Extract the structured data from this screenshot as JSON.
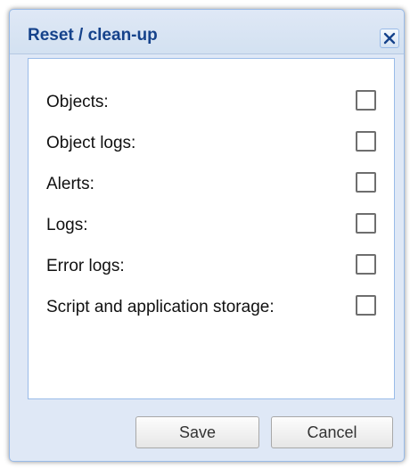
{
  "dialog": {
    "title": "Reset / clean-up",
    "close_icon": "close-icon"
  },
  "options": [
    {
      "label": "Objects:",
      "checked": false
    },
    {
      "label": "Object logs:",
      "checked": false
    },
    {
      "label": "Alerts:",
      "checked": false
    },
    {
      "label": "Logs:",
      "checked": false
    },
    {
      "label": "Error logs:",
      "checked": false
    },
    {
      "label": "Script and application storage:",
      "checked": false
    }
  ],
  "footer": {
    "save_label": "Save",
    "cancel_label": "Cancel"
  },
  "colors": {
    "title_text": "#15428b",
    "dialog_frame": "#dfe8f6",
    "border": "#99bbe8"
  }
}
